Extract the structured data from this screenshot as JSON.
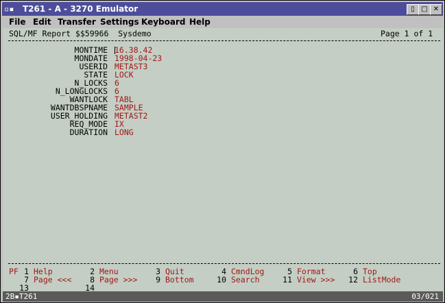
{
  "window": {
    "title": "T261 - A - 3270 Emulator",
    "sys_icon": "terminal-icon",
    "buttons": {
      "minimize": "▯",
      "restore": "□",
      "close": "✕"
    }
  },
  "menu": [
    "File",
    "Edit",
    "Transfer",
    "Settings",
    "Keyboard",
    "Help"
  ],
  "header": {
    "left": "SQL/MF Report $$59966  Sysdemo",
    "right": "Page 1 of 1"
  },
  "fields": [
    {
      "label": "MONTIME",
      "value": "16.38.42"
    },
    {
      "label": "MONDATE",
      "value": "1998-04-23"
    },
    {
      "label": "USERID",
      "value": "METAST3"
    },
    {
      "label": "STATE",
      "value": "LOCK"
    },
    {
      "label": "N_LOCKS",
      "value": "6"
    },
    {
      "label": "N_LONGLOCKS",
      "value": "6"
    },
    {
      "label": "WANTLOCK",
      "value": "TABL"
    },
    {
      "label": "WANTDBSPNAME",
      "value": "SAMPLE"
    },
    {
      "label": "USER_HOLDING",
      "value": "METAST2"
    },
    {
      "label": "REQ_MODE",
      "value": "IX"
    },
    {
      "label": "DURATION",
      "value": "LONG"
    }
  ],
  "pf": {
    "prefix": "PF",
    "row1": [
      {
        "num": "1",
        "label": "Help"
      },
      {
        "num": "2",
        "label": "Menu"
      },
      {
        "num": "3",
        "label": "Quit"
      },
      {
        "num": "4",
        "label": "CmndLog"
      },
      {
        "num": "5",
        "label": "Format"
      },
      {
        "num": "6",
        "label": "Top"
      }
    ],
    "row2": [
      {
        "num": "7",
        "label": "Page <<<"
      },
      {
        "num": "8",
        "label": "Page >>>"
      },
      {
        "num": "9",
        "label": "Bottom"
      },
      {
        "num": "10",
        "label": "Search"
      },
      {
        "num": "11",
        "label": "View >>>"
      },
      {
        "num": "12",
        "label": "ListMode"
      }
    ],
    "row3": [
      {
        "num": "13",
        "label": ""
      },
      {
        "num": "14",
        "label": ""
      }
    ]
  },
  "status": {
    "left": "2B▪T261",
    "right": "03/021"
  }
}
